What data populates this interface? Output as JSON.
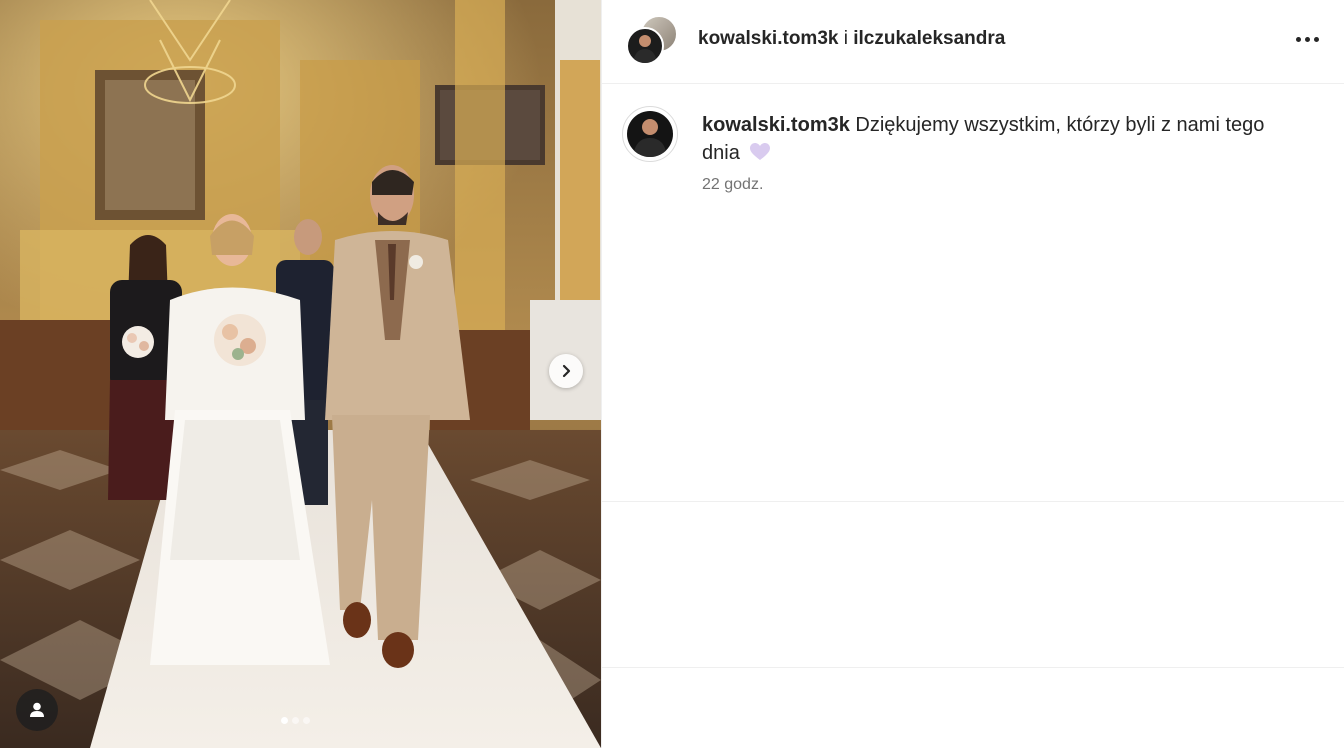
{
  "post": {
    "authors": {
      "primary": "kowalski.tom3k",
      "conjunction": "i",
      "secondary": "ilczukaleksandra"
    },
    "caption": {
      "username": "kowalski.tom3k",
      "text": "Dziękujemy wszystkim, którzy byli z nami tego dnia",
      "emoji": "lavender-heart-icon",
      "time": "22 godz."
    },
    "carousel": {
      "current": 1,
      "total": 3
    }
  },
  "colors": {
    "text": "#262626",
    "muted": "#737373",
    "divider": "#efefef",
    "heart": "#d6c6f0"
  }
}
